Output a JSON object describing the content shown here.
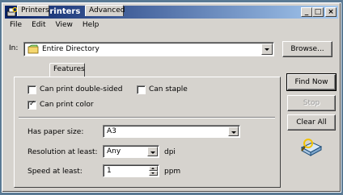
{
  "window": {
    "title": "Find Printers"
  },
  "titlebar_buttons": {
    "minimize": "_",
    "maximize": "□",
    "close": "×"
  },
  "menu": {
    "items": [
      "File",
      "Edit",
      "View",
      "Help"
    ]
  },
  "location": {
    "label": "In:",
    "value": "Entire Directory",
    "browse": "Browse..."
  },
  "tabs": [
    "Printers",
    "Features",
    "Advanced"
  ],
  "active_tab": "Features",
  "features": {
    "double_sided": {
      "label": "Can print double-sided",
      "checked": false
    },
    "staple": {
      "label": "Can staple",
      "checked": false
    },
    "color": {
      "label": "Can print color",
      "checked": true
    }
  },
  "paper": {
    "label": "Has paper size:",
    "value": "A3"
  },
  "resolution": {
    "label": "Resolution at least:",
    "value": "Any",
    "unit": "dpi"
  },
  "speed": {
    "label": "Speed at least:",
    "value": "1",
    "unit": "ppm"
  },
  "actions": {
    "find_now": "Find Now",
    "stop": "Stop",
    "clear_all": "Clear All"
  },
  "colors": {
    "title_start": "#0a246a",
    "title_end": "#a6caf0",
    "face": "#d6d3ce"
  }
}
